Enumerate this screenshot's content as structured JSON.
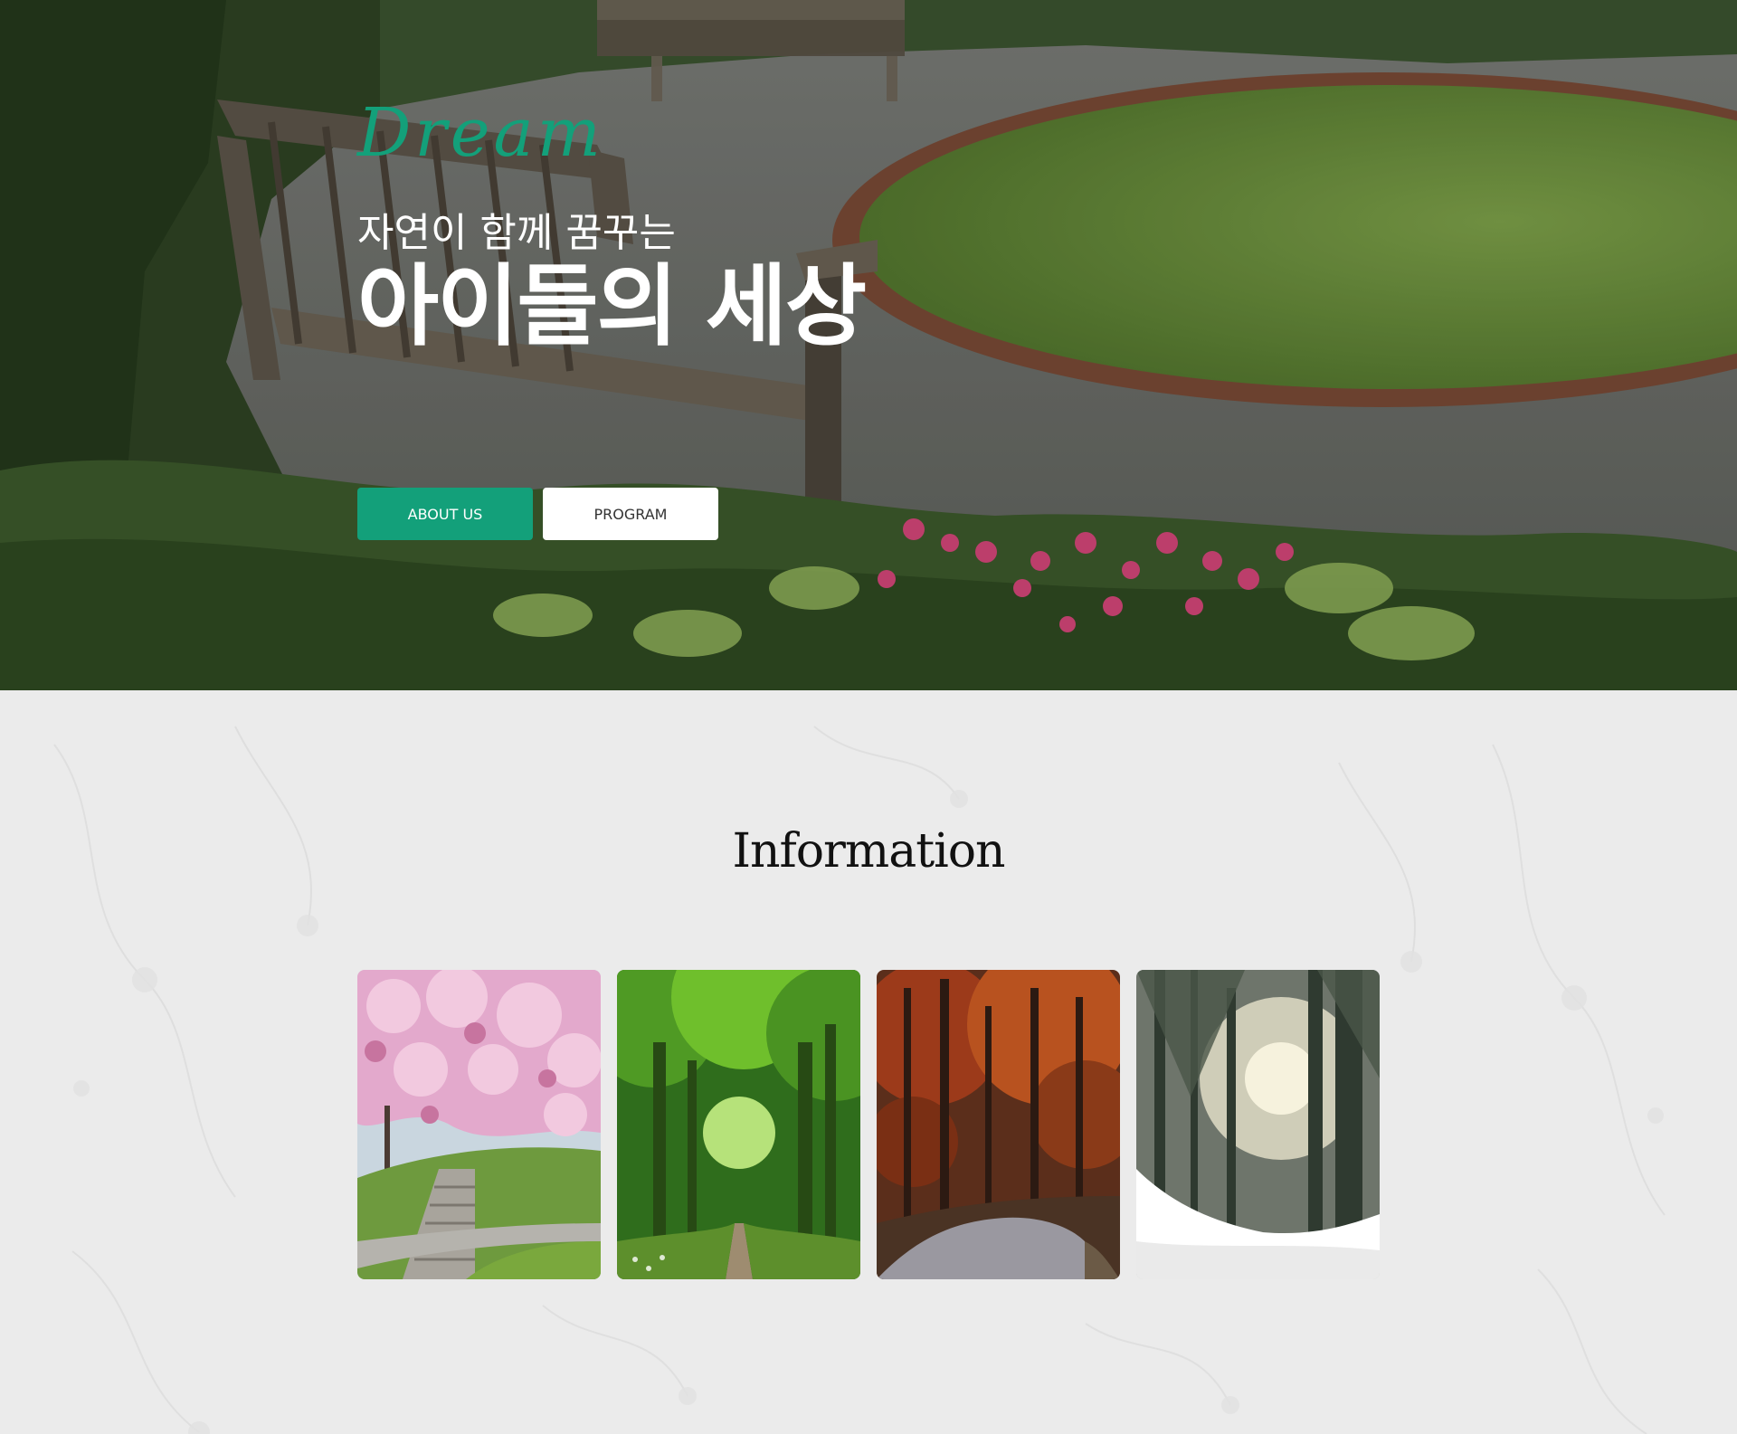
{
  "hero": {
    "script_title": "Dream",
    "subtitle": "자연이 함께 꿈꾸는",
    "title": "아이들의 세상",
    "buttons": {
      "about": "ABOUT US",
      "program": "PROGRAM"
    }
  },
  "info": {
    "title": "Information",
    "cards": [
      "spring-cherry-blossom-stairs",
      "summer-green-forest-path",
      "autumn-red-forest-road",
      "winter-snowy-forest"
    ]
  },
  "colors": {
    "accent": "#13a07a",
    "section_bg": "#ebebeb"
  }
}
